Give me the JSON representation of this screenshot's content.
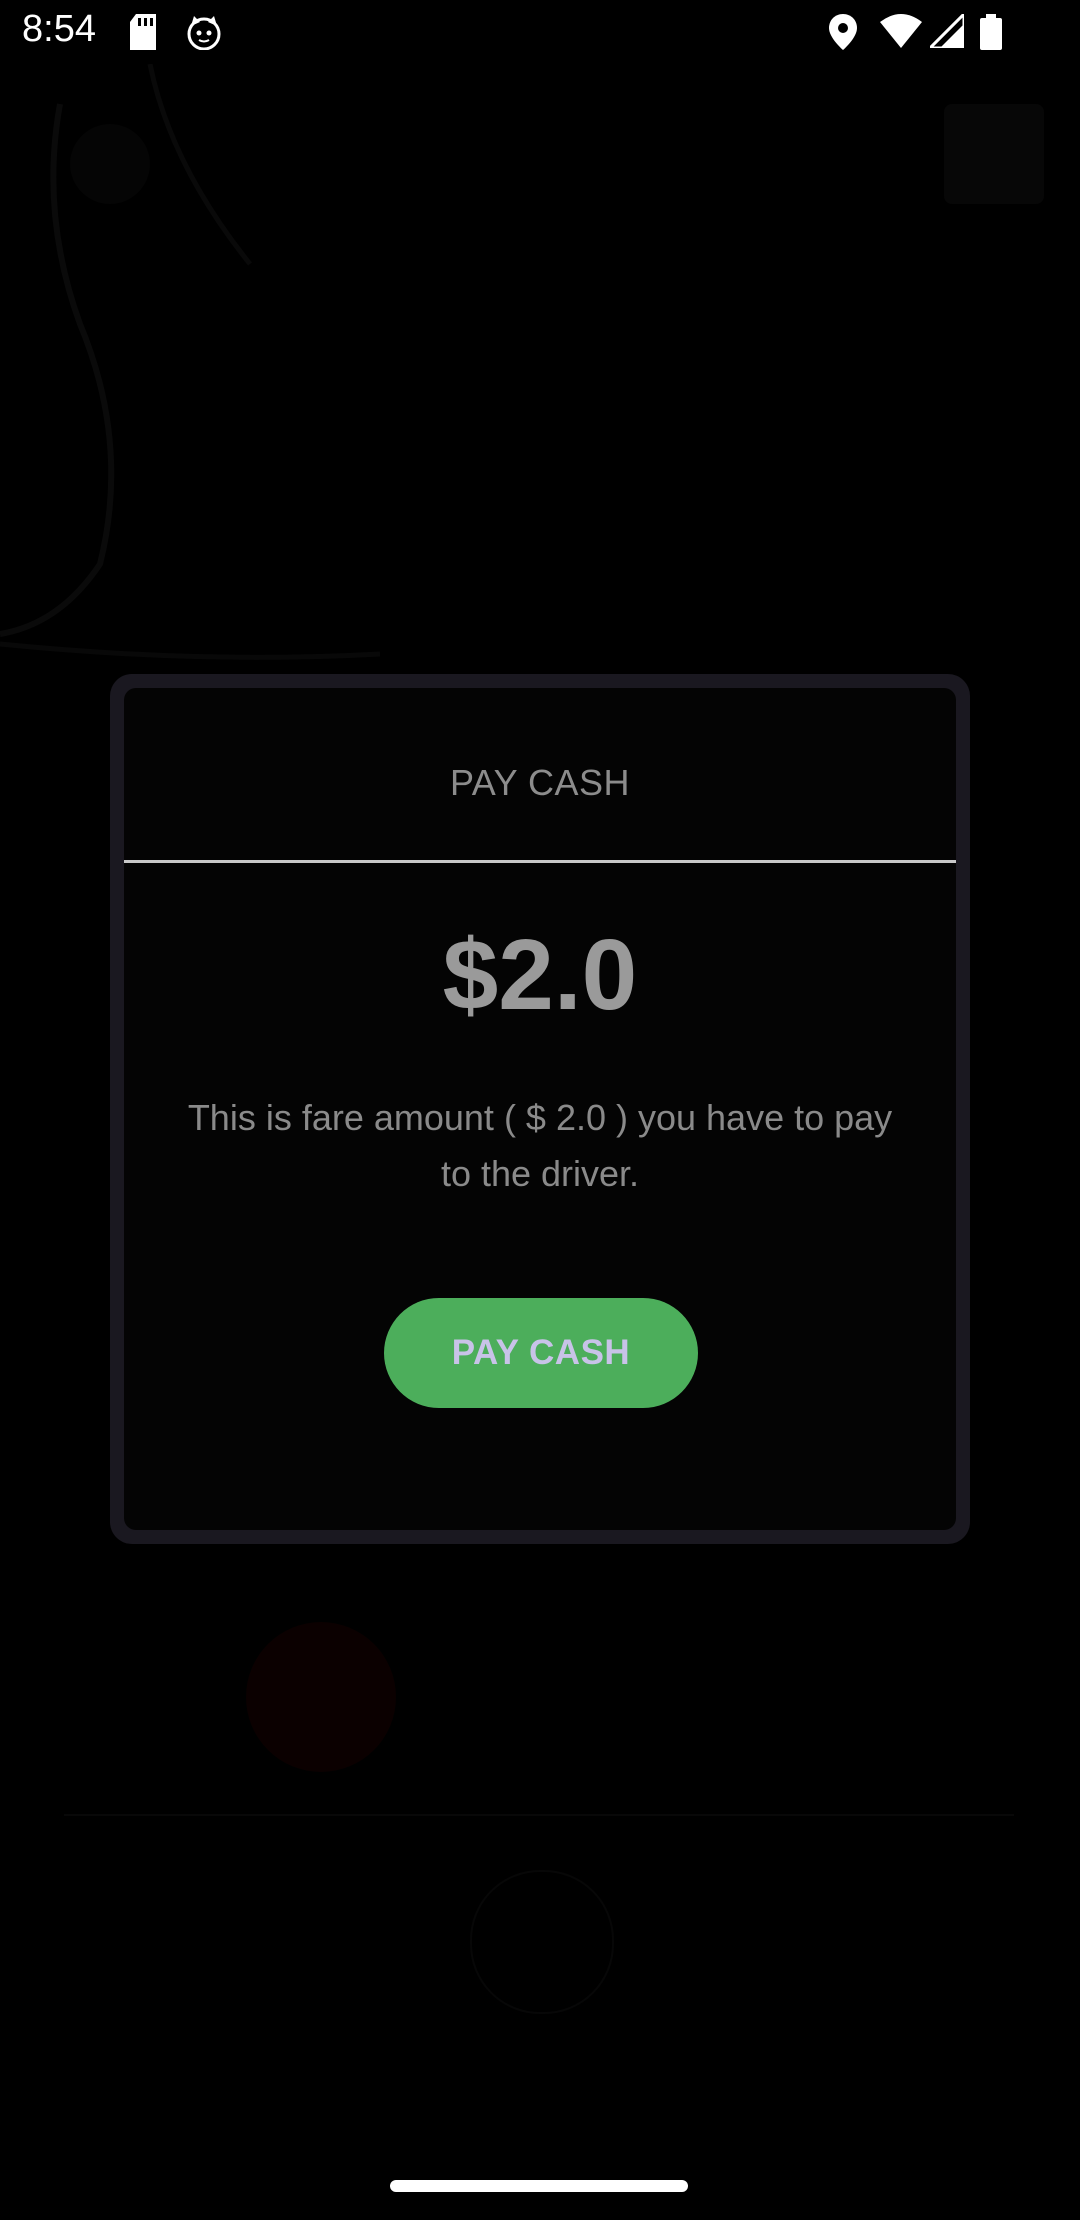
{
  "status_bar": {
    "time": "8:54",
    "left_icons": [
      "sd-card-icon",
      "cat-face-icon"
    ],
    "right_icons": [
      "location-pin-icon",
      "wifi-icon",
      "cell-signal-icon",
      "battery-icon"
    ]
  },
  "background": {
    "location_text": "",
    "driver_name": "",
    "driver_info": "",
    "call_label": ""
  },
  "dialog": {
    "title": "PAY CASH",
    "amount": "$2.0",
    "message": "This is fare amount ( $ 2.0 ) you have to pay to the driver.",
    "button_label": "PAY CASH",
    "button_color": "#4cae5b"
  }
}
